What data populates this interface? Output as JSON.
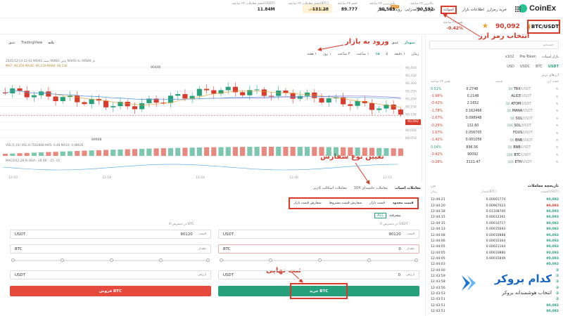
{
  "brand": {
    "name": "CoinEx"
  },
  "nav": {
    "items": [
      "خرید رمزارز",
      "اطلاعات بازار",
      "اسپات",
      "فیوچرز",
      "درآمدزایی",
      "رویدادها",
      "بیشتر"
    ],
    "hot_badge": "HOT",
    "promo": "مرکز پاداش"
  },
  "ticker": {
    "pair": "BTC/USDT",
    "price": "90,092",
    "change_label": "تغییر ۲۴ ساعته",
    "change": "-0.42%",
    "stats": [
      {
        "label": "بالاترین ۲۴ ساعته",
        "value": "90,592"
      },
      {
        "label": "پایین‌ترین ۲۴ ساعته",
        "value": "90,585"
      },
      {
        "label": "حجم ۲۴ ساعته",
        "value": "89.777"
      },
      {
        "label": "حجم معاملات ۲۴ ساعته(BTC)",
        "value": "131.28"
      },
      {
        "label": "حجم معاملات ۲۴ ساعته(USDT)",
        "value": "11.84M"
      }
    ]
  },
  "annotations": {
    "select_crypto": "انتخاب رمز ارز",
    "enter_market": "ورود به بازار",
    "order_type": "تعیین نوع سفارش",
    "final_submit": "ثبت نهایی"
  },
  "market_list": {
    "search_placeholder": "جستجو",
    "filters": [
      "USDT",
      "BTC",
      "USDC",
      "USD"
    ],
    "sub_tabs": [
      "بازار اسپات",
      "Pre-Token",
      "x102"
    ],
    "section": "ارزهای برتر",
    "headers": [
      "جفت ارز",
      "قیمت",
      "تغییر ۲۴ ساعته"
    ],
    "rows": [
      {
        "sym": "TRX",
        "quote": "/USDT",
        "lev": "5X",
        "price": "0.2748",
        "change": "0.51%",
        "dir": "pos"
      },
      {
        "sym": "ALICE",
        "quote": "/USDT",
        "lev": "",
        "price": "0.2148",
        "change": "-1.96%",
        "dir": "neg"
      },
      {
        "sym": "ATOM",
        "quote": "/USDT",
        "lev": "5X",
        "price": "2.1652",
        "change": "-0.42%",
        "dir": "neg"
      },
      {
        "sym": "MANA",
        "quote": "/USDT",
        "lev": "5X",
        "price": "0.162466",
        "change": "-1.78%",
        "dir": "neg"
      },
      {
        "sym": "SOL",
        "quote": "/USDT",
        "lev": "5X",
        "price": "0.098948",
        "change": "-1.67%",
        "dir": "neg"
      },
      {
        "sym": "SOL",
        "quote": "/USDT",
        "lev": "10X",
        "price": "132.60",
        "change": "-0.25%",
        "dir": "neg"
      },
      {
        "sym": "FOUS",
        "quote": "/USDT",
        "lev": "",
        "price": "0.056705",
        "change": "-1.67%",
        "dir": "neg"
      },
      {
        "sym": "BNB",
        "quote": "/USDT",
        "lev": "5X",
        "price": "0.001056",
        "change": "-1.42%",
        "dir": "neg"
      },
      {
        "sym": "BNB",
        "quote": "/USDT",
        "lev": "5X",
        "price": "896.56",
        "change": "0.04%",
        "dir": "pos"
      },
      {
        "sym": "BTC",
        "quote": "/USDT",
        "lev": "10X",
        "price": "90092",
        "change": "-0.42%",
        "dir": "neg"
      },
      {
        "sym": "ETH",
        "quote": "/USDT",
        "lev": "10X",
        "price": "3111.47",
        "change": "-0.26%",
        "dir": "neg"
      }
    ]
  },
  "chart": {
    "tabs": [
      "نمودار",
      "عمق"
    ],
    "intervals": [
      "زمان",
      "۱ دقیقه",
      "۵",
      "۱۵",
      "۱ ساعت",
      "۴ ساعت",
      "۱ روز",
      "۱ هفته"
    ],
    "views": [
      "پایه",
      "TradingView",
      "عمق"
    ],
    "header": "2025/12/14 12:43  باز 90089  بالا 90093  پایین 90083  بسته 90092",
    "ma_line": "MA7: 90,059  MA30: 90,118  MA60: 90,130",
    "vol_line": "VOL(5,10)  VOL:0.7502808  MA5: 0.48  MA10: 0.98635",
    "macd_line": "MACD(12,26,9)  DEA: -18  DIF: -15  -15",
    "high_mark": "90400",
    "low_mark": "89908",
    "current": "90,092",
    "y_ticks": [
      "90,400",
      "90,350",
      "90,300",
      "90,250",
      "90,200",
      "90,150",
      "90,100",
      "90,050",
      "90,000",
      "89,950"
    ],
    "x_ticks": [
      "12:03",
      "12:18",
      "12:24",
      "12:40",
      "12:53"
    ]
  },
  "trades": {
    "title": "تاریخچه معاملات",
    "mine": "من",
    "headers": [
      "قیمت(USDT)",
      "مقدار(BTC)",
      "زمان"
    ],
    "rows": [
      [
        "90,092",
        "0.00001774",
        "12:44:21",
        "pos"
      ],
      [
        "90,093",
        "0.00967023",
        "12:44:20",
        "neg"
      ],
      [
        "90,093",
        "0.01108700",
        "12:44:18",
        "pos"
      ],
      [
        "90,093",
        "0.00012361",
        "12:44:15",
        "pos"
      ],
      [
        "90,092",
        "0.00010717",
        "12:44:15",
        "pos"
      ],
      [
        "90,092",
        "0.00015693",
        "12:44:13",
        "pos"
      ],
      [
        "90,092",
        "0.00010888",
        "12:44:08",
        "pos"
      ],
      [
        "90,092",
        "0.00010364",
        "12:44:06",
        "pos"
      ],
      [
        "90,092",
        "0.00021164",
        "12:44:05",
        "pos"
      ],
      [
        "90,092",
        "0.00010880",
        "12:44:05",
        "pos"
      ],
      [
        "90,093",
        "0.00015849",
        "12:44:05",
        "pos"
      ],
      [
        "90,092",
        "",
        "12:44:03",
        "pos"
      ],
      [
        "90,093",
        "",
        "12:44:00",
        "pos"
      ],
      [
        "90,092",
        "",
        "12:43:59",
        "pos"
      ],
      [
        "90,093",
        "",
        "12:43:58",
        "pos"
      ],
      [
        "90,092",
        "",
        "12:43:56",
        "pos"
      ],
      [
        "90,092",
        "",
        "12:43:53",
        "pos"
      ],
      [
        "90,092",
        "",
        "12:43:51",
        "pos"
      ],
      [
        "90,092",
        "",
        "12:43:51",
        "pos"
      ],
      [
        "90,092",
        "",
        "12:43:51",
        "pos"
      ]
    ]
  },
  "order": {
    "tabs": [
      "معاملات اسپات",
      "معاملات حاشیه‌ای 10X",
      "معاملات اسکالپ کارتی"
    ],
    "types": [
      "قیمت محدود",
      "قیمت بازار",
      "سفارش قیمت مشروط",
      "سفارش قیمت بازار"
    ],
    "fee_label": "پیشرفته",
    "fee_toggle": "ALL",
    "buy": {
      "available": "در دسترس  0 USDT",
      "price_label": "قیمت",
      "price_value": "90120",
      "price_unit": "USDT",
      "amount_label": "مقدار",
      "amount_value": "0",
      "amount_unit": "BTC",
      "total_label": "ارزش",
      "total_value": "0",
      "total_unit": "USDT",
      "button": "خرید BTC"
    },
    "sell": {
      "available": "در دسترس  0 BTC",
      "price_label": "قیمت",
      "price_value": "90120",
      "price_unit": "USDT",
      "amount_label": "مقدار",
      "amount_unit": "BTC",
      "total_label": "ارزش",
      "total_unit": "USDT",
      "button": "فروش BTC"
    }
  },
  "watermark": {
    "title": "کدام بروکر",
    "subtitle": "انتخاب هوشمندانه بروکر"
  },
  "colors": {
    "up": "#27a17a",
    "down": "#d83a2b",
    "buy": "#26a17b",
    "sell": "#e5493b",
    "accent": "#d83a2b"
  }
}
